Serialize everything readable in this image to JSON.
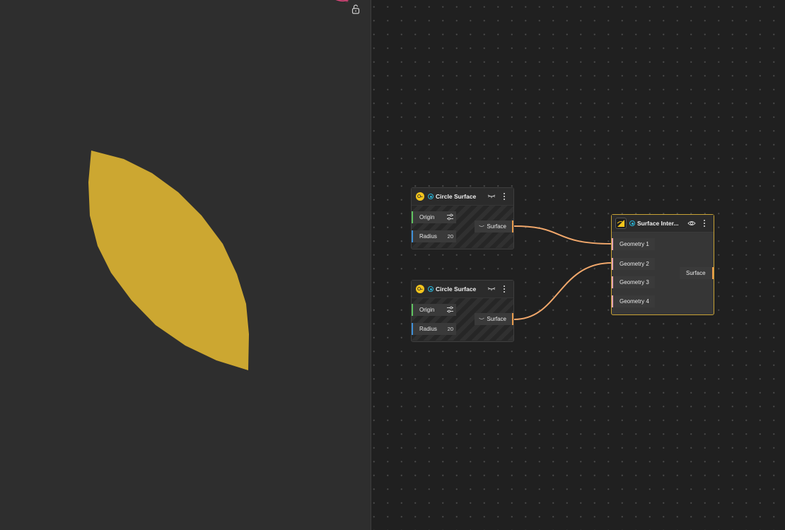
{
  "viewport": {
    "shape_color": "#cca731",
    "background": "#2e2e2e"
  },
  "canvas": {
    "background": "#202020",
    "wire_color": "#f0a76b"
  },
  "nodes": {
    "circle1": {
      "title": "Circle Surface",
      "inputs": [
        {
          "label": "Origin",
          "value": ""
        },
        {
          "label": "Radius",
          "value": "20"
        }
      ],
      "output": "Surface"
    },
    "circle2": {
      "title": "Circle Surface",
      "inputs": [
        {
          "label": "Origin",
          "value": ""
        },
        {
          "label": "Radius",
          "value": "20"
        }
      ],
      "output": "Surface"
    },
    "intersect": {
      "title": "Surface Inter...",
      "inputs": [
        {
          "label": "Geometry 1"
        },
        {
          "label": "Geometry 2"
        },
        {
          "label": "Geometry 3"
        },
        {
          "label": "Geometry 4"
        }
      ],
      "output": "Surface"
    }
  }
}
